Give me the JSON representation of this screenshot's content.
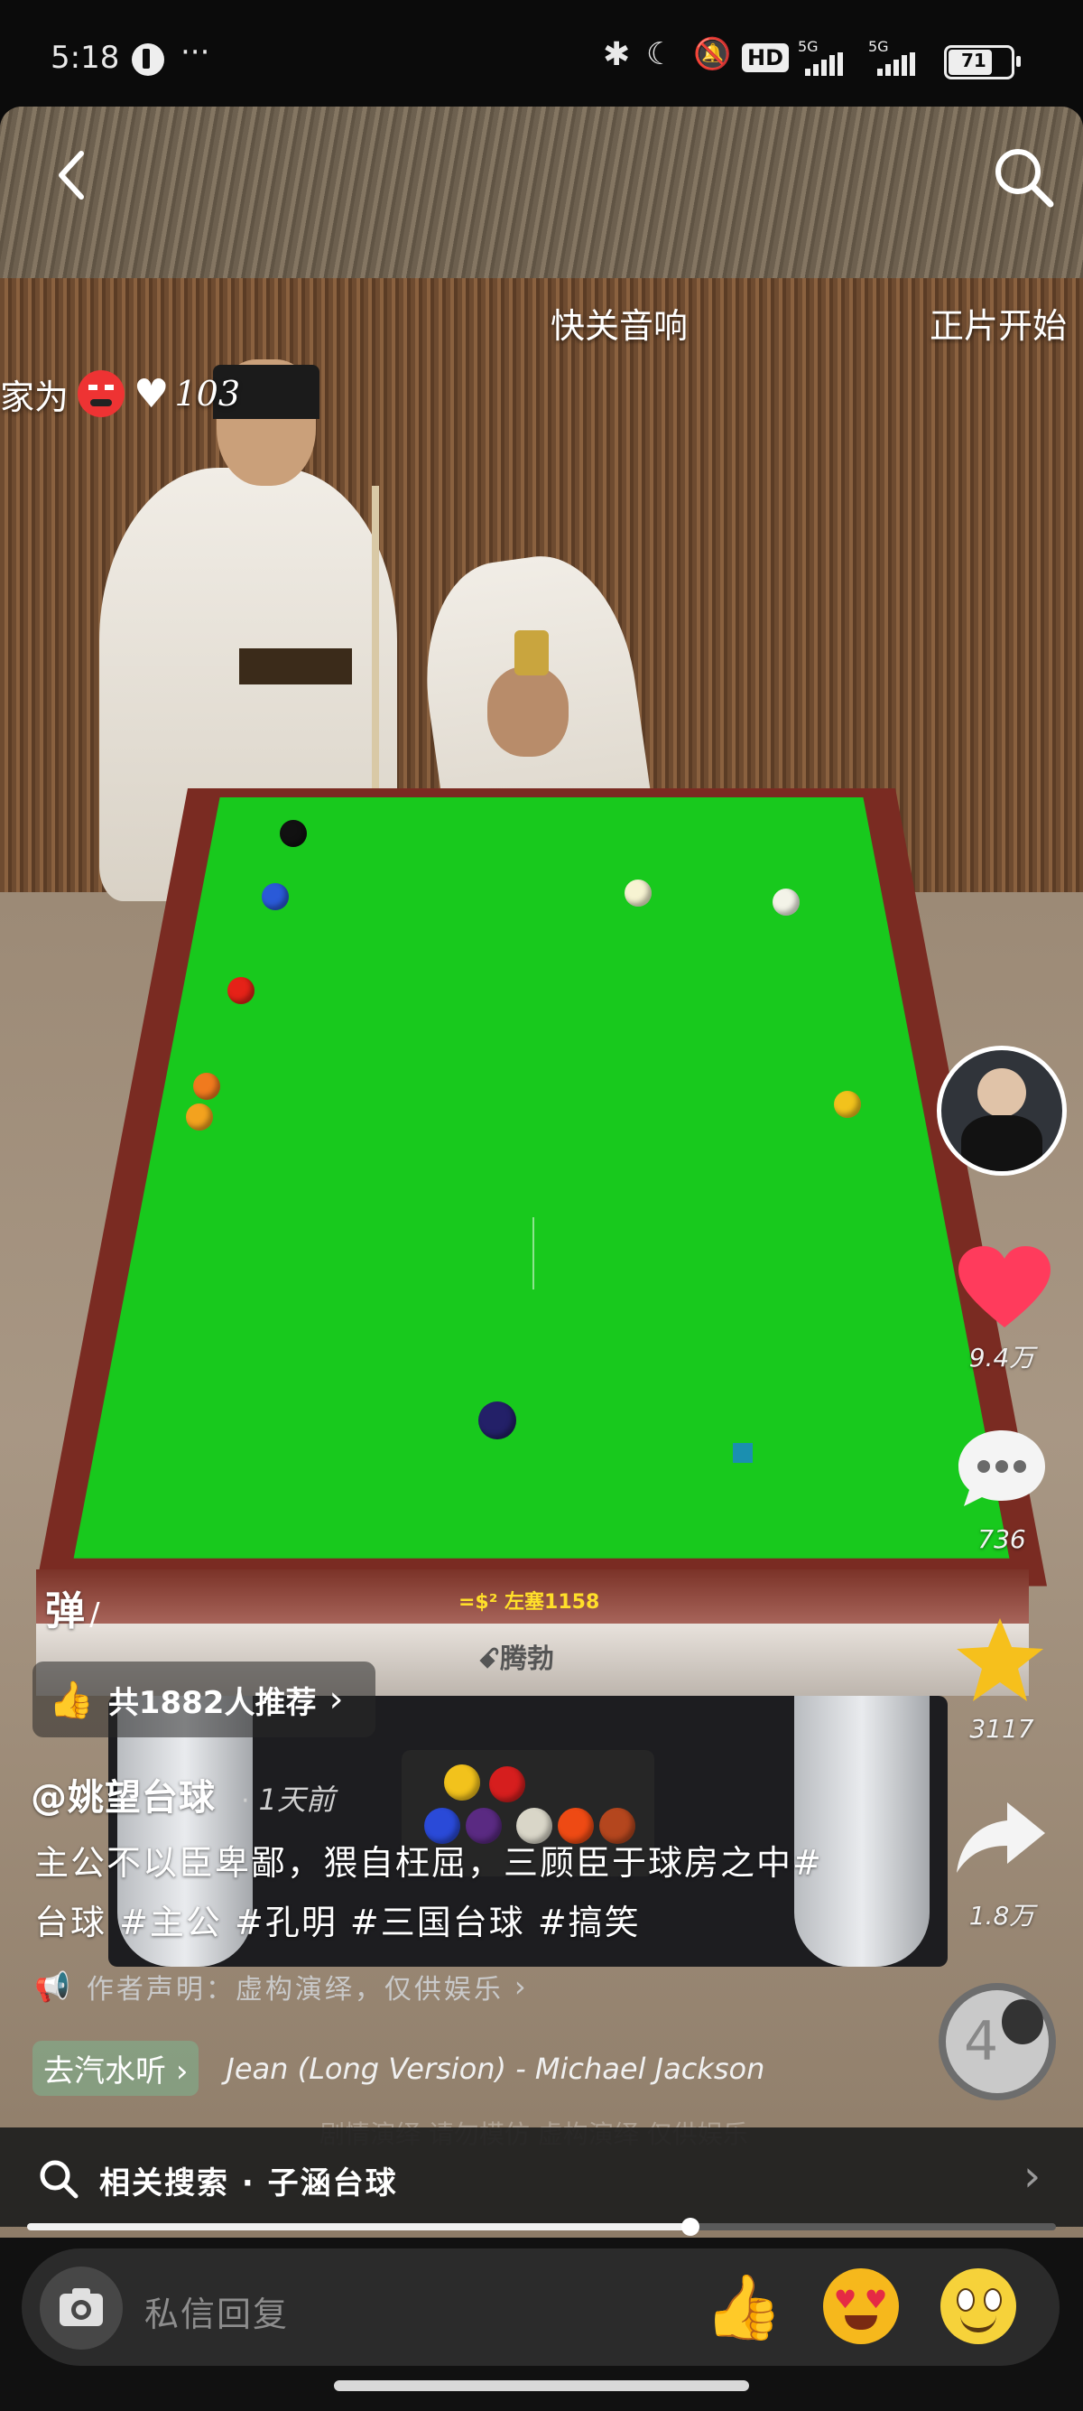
{
  "status_bar": {
    "time": "5:18",
    "more": "···",
    "hd_badge": "HD",
    "net1": "5G",
    "net2": "5G",
    "battery": "71"
  },
  "video": {
    "mute_hint": "快关音响",
    "main_start": "正片开始",
    "danmu_prefix": "家为",
    "danmu_like_count": "103",
    "rail_text": "=$² 左塞1158",
    "brand_text": "ꗃ腾勃"
  },
  "actions": {
    "like_count": "9.4万",
    "comment_count": "736",
    "favorite_count": "3117",
    "share_count": "1.8万"
  },
  "info": {
    "danmu_toggle": "弹",
    "recommend_label": "共1882人推荐",
    "author": "@姚望台球",
    "time_ago": "1天前",
    "description": "主公不以臣卑鄙，猥自枉屈，三顾臣于球房之中#台球 #主公 #孔明 #三国台球 #搞笑",
    "disclaimer": "作者声明：虚构演绎，仅供娱乐",
    "music_chip": "去汽水听",
    "music_track": "Jean (Long Version) - Michael Jackson",
    "watermark": "剧情演绎 请勿模仿 虚构演绎 仅供娱乐"
  },
  "related_search": {
    "label": "相关搜索 · 子涵台球"
  },
  "progress": {
    "fraction": 0.645
  },
  "comment_bar": {
    "placeholder": "私信回复"
  },
  "colors": {
    "like_red": "#ff3b5c",
    "star_yellow": "#f6c01c",
    "felt_green": "#18c91d"
  }
}
